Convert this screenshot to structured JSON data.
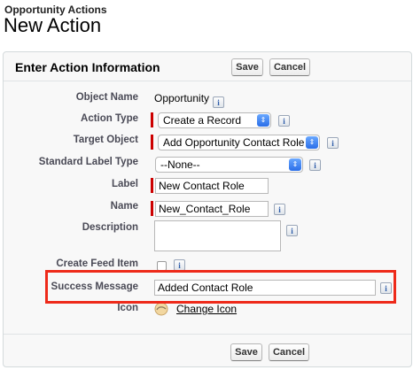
{
  "page": {
    "subtitle": "Opportunity Actions",
    "title": "New Action"
  },
  "panel": {
    "title": "Enter Action Information",
    "save_label": "Save",
    "cancel_label": "Cancel"
  },
  "fields": {
    "object_name": {
      "label": "Object Name",
      "value": "Opportunity"
    },
    "action_type": {
      "label": "Action Type",
      "value": "Create a Record"
    },
    "target_object": {
      "label": "Target Object",
      "value": "Add Opportunity Contact Role"
    },
    "standard_label_type": {
      "label": "Standard Label Type",
      "value": "--None--"
    },
    "label": {
      "label": "Label",
      "value": "New Contact Role"
    },
    "name": {
      "label": "Name",
      "value": "New_Contact_Role"
    },
    "description": {
      "label": "Description",
      "value": ""
    },
    "create_feed_item": {
      "label": "Create Feed Item",
      "checked": false
    },
    "success_message": {
      "label": "Success Message",
      "value": "Added Contact Role"
    },
    "icon": {
      "label": "Icon",
      "link_label": "Change Icon"
    }
  },
  "info_glyph": "i",
  "select_arrow": "⇕",
  "colors": {
    "required_bar": "#cc0000",
    "highlight": "#ee2a1a"
  }
}
